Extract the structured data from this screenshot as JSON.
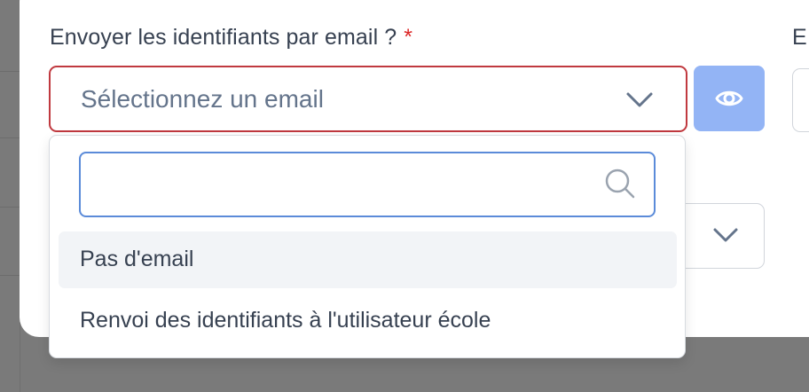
{
  "form": {
    "field_label": "Envoyer les identifiants par email ?",
    "required_marker": "*",
    "next_field_label_fragment": "E",
    "email_select": {
      "placeholder": "Sélectionnez un email",
      "state": "open",
      "search_value": "",
      "options": [
        {
          "label": "Pas d'email",
          "highlighted": true
        },
        {
          "label": "Renvoi des identifiants à l'utilisateur école",
          "highlighted": false
        }
      ]
    },
    "preview_button": {
      "icon": "eye-icon"
    }
  },
  "icons": {
    "select_chevron": "chevron-down-icon",
    "search": "search-icon",
    "behind_select_chevron": "chevron-down-icon"
  },
  "colors": {
    "error_border": "#c0393f",
    "required_star": "#dc2626",
    "preview_button_bg": "#93b4f5",
    "search_focus_border": "#5b8bd9",
    "option_highlight": "#f2f4f7"
  }
}
